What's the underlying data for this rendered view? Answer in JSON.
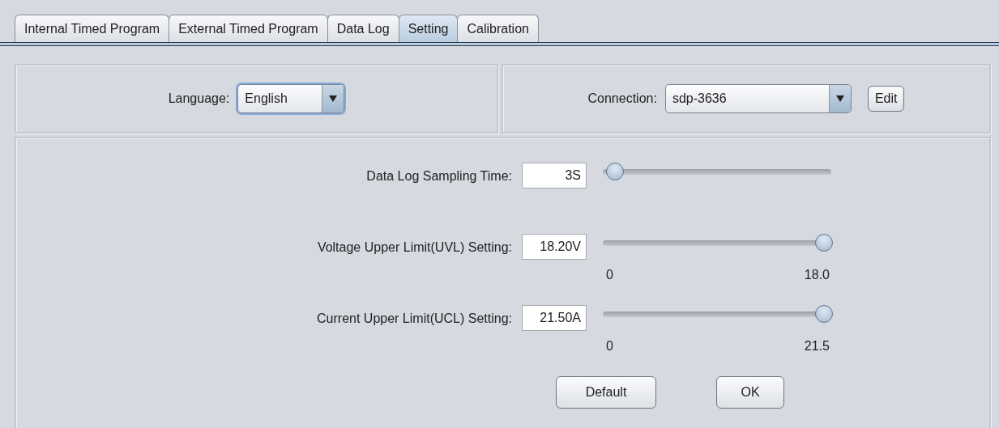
{
  "tabs": [
    {
      "label": "Internal Timed Program",
      "selected": false
    },
    {
      "label": "External Timed Program",
      "selected": false
    },
    {
      "label": "Data Log",
      "selected": false
    },
    {
      "label": "Setting",
      "selected": true
    },
    {
      "label": "Calibration",
      "selected": false
    }
  ],
  "language": {
    "label": "Language:",
    "value": "English"
  },
  "connection": {
    "label": "Connection:",
    "value": "sdp-3636",
    "edit_button": "Edit"
  },
  "settings": [
    {
      "label": "Data Log Sampling Time:",
      "value": "3S",
      "level": 0.03
    },
    {
      "label": "Voltage Upper Limit(UVL) Setting:",
      "value": "18.20V",
      "level": 1,
      "min_label": "0",
      "max_label": "18.0"
    },
    {
      "label": "Current Upper Limit(UCL) Setting:",
      "value": "21.50A",
      "level": 1,
      "min_label": "0",
      "max_label": "21.5"
    }
  ],
  "buttons": [
    "Default",
    "OK"
  ]
}
